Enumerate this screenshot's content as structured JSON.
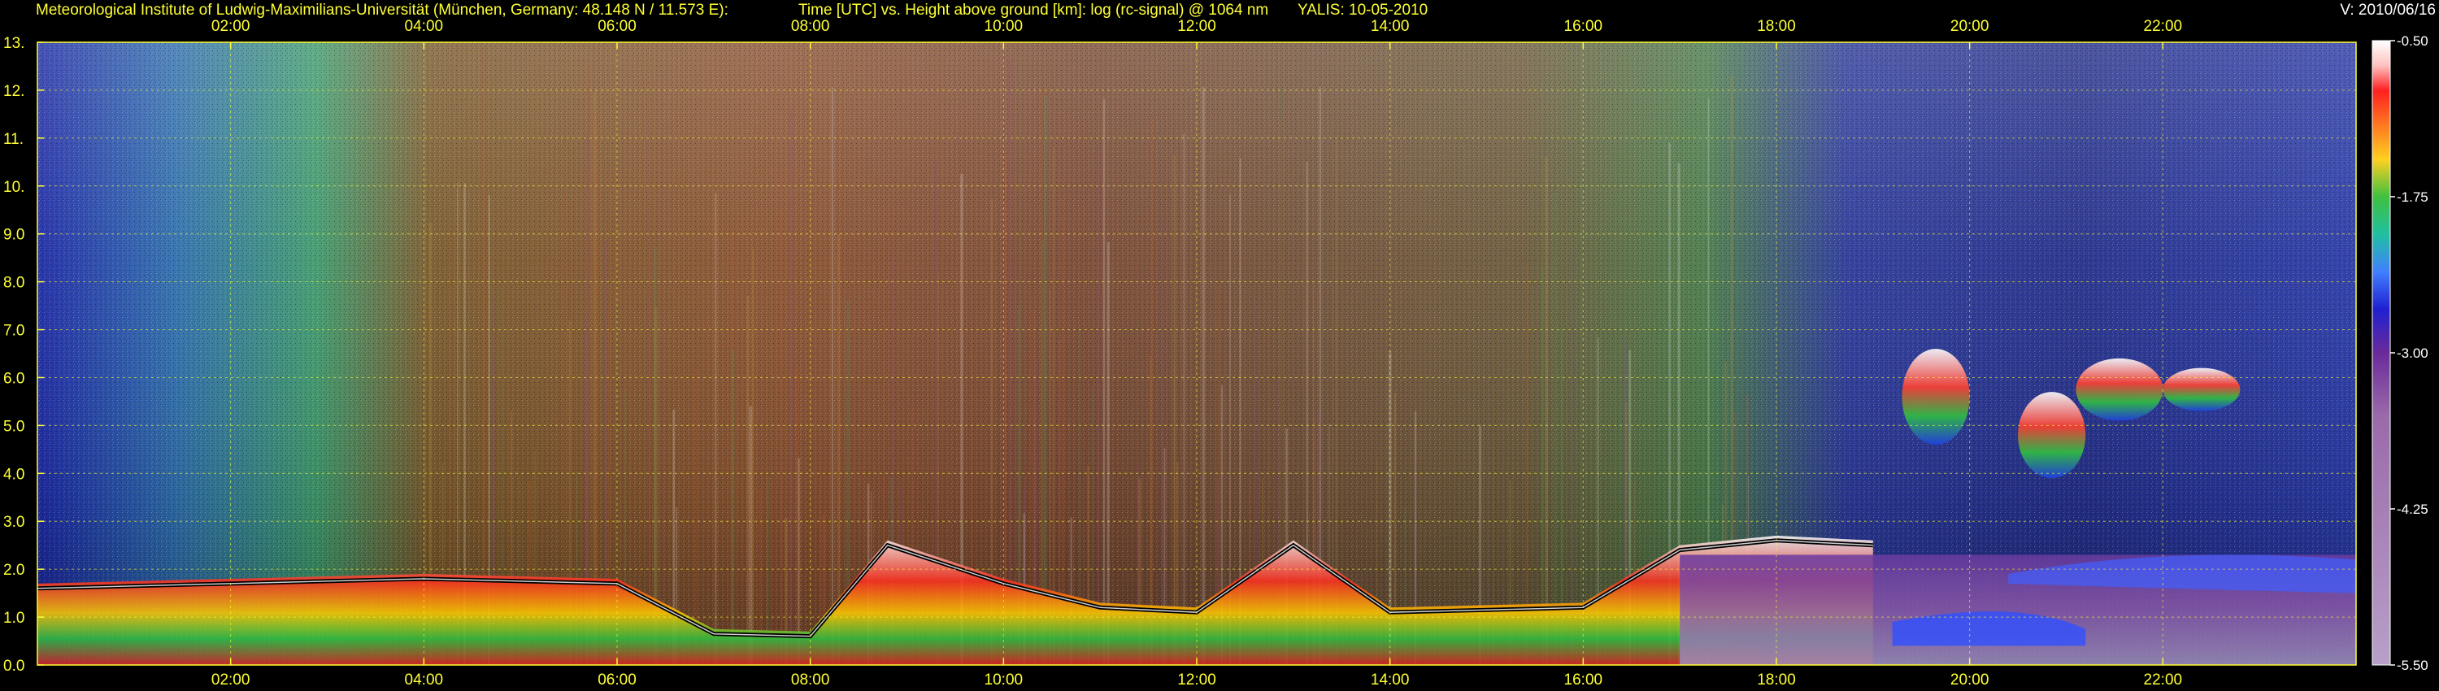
{
  "header": {
    "institute": "Meteorological Institute of Ludwig-Maximilians-Universität (München, Germany: 48.148 N / 11.573 E):",
    "axis_description": "Time [UTC] vs. Height above ground [km]: log (rc-signal) @ 1064 nm",
    "instrument_date": "YALIS: 10-05-2010",
    "version": "V: 2010/06/16"
  },
  "chart_data": {
    "type": "heatmap",
    "title": "Time [UTC] vs. Height above ground [km]: log (rc-signal) @ 1064 nm",
    "xlabel": "Time [UTC]",
    "ylabel": "Height above ground [km]",
    "x_range_hours": [
      0.0,
      24.0
    ],
    "y_range_km": [
      0.0,
      13.0
    ],
    "x_ticks": [
      "02:00",
      "04:00",
      "06:00",
      "08:00",
      "10:00",
      "12:00",
      "14:00",
      "16:00",
      "18:00",
      "20:00",
      "22:00"
    ],
    "x_tick_hours": [
      2,
      4,
      6,
      8,
      10,
      12,
      14,
      16,
      18,
      20,
      22
    ],
    "y_ticks": [
      "0.0",
      "1.0",
      "2.0",
      "3.0",
      "4.0",
      "5.0",
      "6.0",
      "7.0",
      "8.0",
      "9.0",
      "10.",
      "11.",
      "12.",
      "13."
    ],
    "y_tick_km": [
      0,
      1,
      2,
      3,
      4,
      5,
      6,
      7,
      8,
      9,
      10,
      11,
      12,
      13
    ],
    "grid": true,
    "colorbar": {
      "label_values": [
        "-0.50",
        "-1.75",
        "-3.00",
        "-4.25",
        "-5.50"
      ],
      "range": [
        -5.5,
        -0.5
      ]
    },
    "features": {
      "boundary_layer_top_km": [
        [
          0.0,
          1.7
        ],
        [
          2.0,
          1.8
        ],
        [
          4.0,
          1.9
        ],
        [
          6.0,
          1.8
        ],
        [
          7.0,
          0.75
        ],
        [
          8.0,
          0.7
        ],
        [
          8.8,
          2.6
        ],
        [
          10.0,
          1.8
        ],
        [
          11.0,
          1.3
        ],
        [
          12.0,
          1.2
        ],
        [
          13.0,
          2.6
        ],
        [
          14.0,
          1.2
        ],
        [
          16.0,
          1.3
        ],
        [
          17.0,
          2.5
        ],
        [
          18.0,
          2.7
        ],
        [
          19.0,
          2.6
        ]
      ],
      "cloud_patches": [
        {
          "start_hour": 19.3,
          "end_hour": 20.0,
          "base_km": 4.6,
          "top_km": 6.6
        },
        {
          "start_hour": 20.5,
          "end_hour": 21.2,
          "base_km": 3.9,
          "top_km": 5.7
        },
        {
          "start_hour": 21.1,
          "end_hour": 22.0,
          "base_km": 5.1,
          "top_km": 6.4
        },
        {
          "start_hour": 22.0,
          "end_hour": 22.8,
          "base_km": 5.3,
          "top_km": 6.2
        }
      ]
    }
  }
}
